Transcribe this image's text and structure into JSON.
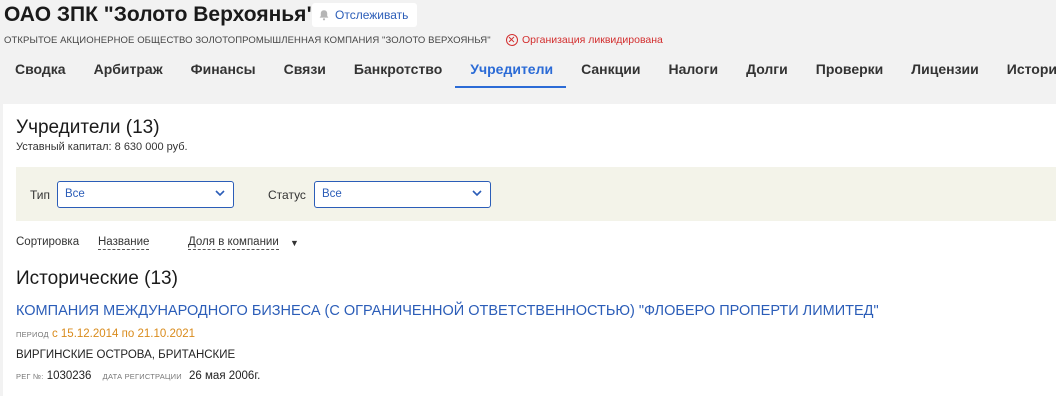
{
  "header": {
    "title": "ОАО ЗПК \"Золото Верхоянья\"",
    "follow_label": "Отслеживать",
    "full_name": "ОТКРЫТОЕ АКЦИОНЕРНОЕ ОБЩЕСТВО ЗОЛОТОПРОМЫШЛЕННАЯ КОМПАНИЯ \"ЗОЛОТО ВЕРХОЯНЬЯ\"",
    "status": "Организация ликвидирована"
  },
  "tabs": [
    {
      "label": "Сводка"
    },
    {
      "label": "Арбитраж"
    },
    {
      "label": "Финансы"
    },
    {
      "label": "Связи"
    },
    {
      "label": "Банкротство"
    },
    {
      "label": "Учредители"
    },
    {
      "label": "Санкции"
    },
    {
      "label": "Налоги"
    },
    {
      "label": "Долги"
    },
    {
      "label": "Проверки"
    },
    {
      "label": "Лицензии"
    },
    {
      "label": "История"
    }
  ],
  "active_tab": "Учредители",
  "section": {
    "title": "Учредители (13)",
    "capital": "Уставный капитал: 8 630 000 руб."
  },
  "filters": {
    "type_label": "Тип",
    "type_value": "Все",
    "status_label": "Статус",
    "status_value": "Все"
  },
  "sorting": {
    "label": "Сортировка",
    "by_name": "Название",
    "by_share": "Доля в компании",
    "direction_glyph": "▼"
  },
  "historical": {
    "title": "Исторические (13)",
    "items": [
      {
        "name": "КОМПАНИЯ МЕЖДУНАРОДНОГО БИЗНЕСА (С ОГРАНИЧЕННОЙ ОТВЕТСТВЕННОСТЬЮ) \"ФЛОБЕРО ПРОПЕРТИ ЛИМИТЕД\"",
        "period_label": "ПЕРИОД",
        "period": "с 15.12.2014 по 21.10.2021",
        "country": "ВИРГИНСКИЕ ОСТРОВА, БРИТАНСКИЕ",
        "reg_label": "РЕГ №:",
        "reg_number": "1030236",
        "reg_date_label": "ДАТА РЕГИСТРАЦИИ",
        "reg_date": "26 мая 2006г."
      }
    ]
  },
  "colors": {
    "accent": "#2b6bd6",
    "link": "#2b5db8",
    "danger": "#d32f2f",
    "period": "#d98b1c",
    "filter_bg": "#f3f3e9"
  }
}
